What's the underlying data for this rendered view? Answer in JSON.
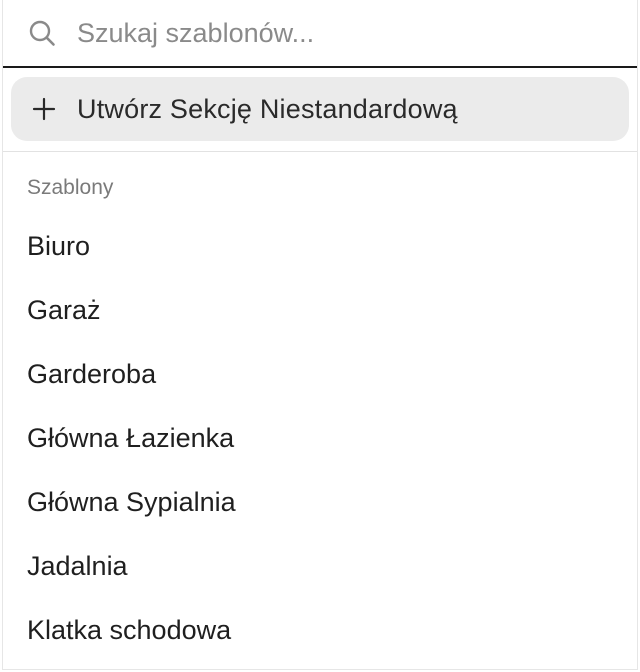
{
  "search": {
    "icon": "search-icon",
    "placeholder": "Szukaj szablonów..."
  },
  "create_button": {
    "icon": "plus-icon",
    "label": "Utwórz Sekcję Niestandardową"
  },
  "templates": {
    "section_label": "Szablony",
    "items": [
      {
        "label": "Biuro"
      },
      {
        "label": "Garaż"
      },
      {
        "label": "Garderoba"
      },
      {
        "label": "Główna Łazienka"
      },
      {
        "label": "Główna Sypialnia"
      },
      {
        "label": "Jadalnia"
      },
      {
        "label": "Klatka schodowa"
      }
    ]
  },
  "colors": {
    "button_bg": "#ebebeb",
    "divider": "#1a1a1a",
    "placeholder": "#8a8a8a",
    "section_label": "#7a7a7a"
  }
}
